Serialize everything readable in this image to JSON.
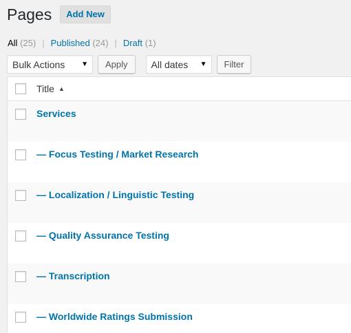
{
  "header": {
    "title": "Pages",
    "add_new_label": "Add New"
  },
  "views": [
    {
      "label": "All",
      "count": "(25)",
      "current": true
    },
    {
      "label": "Published",
      "count": "(24)",
      "current": false
    },
    {
      "label": "Draft",
      "count": "(1)",
      "current": false
    }
  ],
  "tablenav": {
    "bulk_actions": "Bulk Actions",
    "apply_label": "Apply",
    "dates": "All dates",
    "filter_label": "Filter"
  },
  "table": {
    "title_header": "Title",
    "rows": [
      {
        "title": "Services"
      },
      {
        "title": "— Focus Testing / Market Research"
      },
      {
        "title": "— Localization / Linguistic Testing"
      },
      {
        "title": "— Quality Assurance Testing"
      },
      {
        "title": "— Transcription"
      },
      {
        "title": "— Worldwide Ratings Submission"
      }
    ]
  },
  "colors": {
    "link": "#0073aa",
    "background": "#f1f1f1"
  }
}
